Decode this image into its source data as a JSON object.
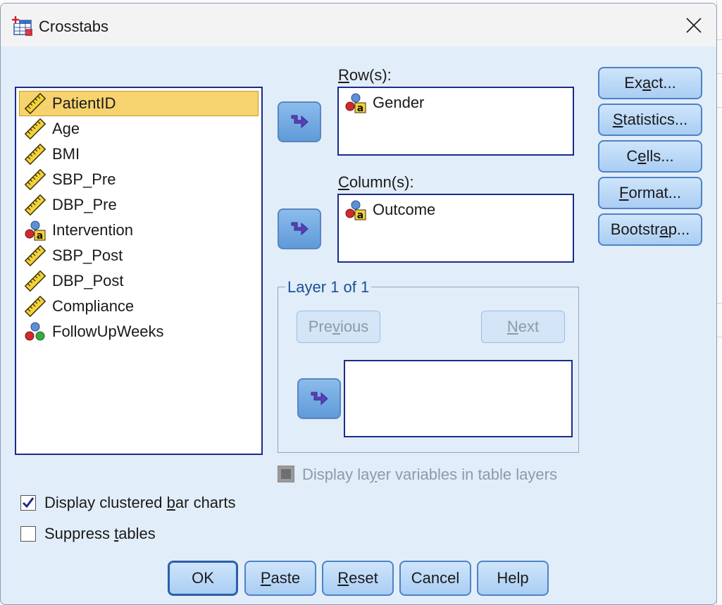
{
  "window": {
    "title": "Crosstabs"
  },
  "variables": [
    {
      "label": "PatientID",
      "icon": "scale-ruler-icon",
      "selected": true
    },
    {
      "label": "Age",
      "icon": "scale-ruler-icon"
    },
    {
      "label": "BMI",
      "icon": "scale-ruler-icon"
    },
    {
      "label": "SBP_Pre",
      "icon": "scale-ruler-icon"
    },
    {
      "label": "DBP_Pre",
      "icon": "scale-ruler-icon"
    },
    {
      "label": "Intervention",
      "icon": "nominal-string-icon"
    },
    {
      "label": "SBP_Post",
      "icon": "scale-ruler-icon"
    },
    {
      "label": "DBP_Post",
      "icon": "scale-ruler-icon"
    },
    {
      "label": "Compliance",
      "icon": "scale-ruler-icon"
    },
    {
      "label": "FollowUpWeeks",
      "icon": "nominal-icon"
    }
  ],
  "rows": {
    "label": "Row(s):",
    "items": [
      {
        "label": "Gender",
        "icon": "nominal-string-icon"
      }
    ]
  },
  "columns": {
    "label": "Column(s):",
    "items": [
      {
        "label": "Outcome",
        "icon": "nominal-string-icon"
      }
    ]
  },
  "layer": {
    "title": "Layer 1 of 1",
    "previous": "Previous",
    "next": "Next"
  },
  "side_buttons": {
    "exact": "Exact...",
    "statistics": "Statistics...",
    "cells": "Cells...",
    "format": "Format...",
    "bootstrap": "Bootstrap..."
  },
  "options": {
    "display_layer_vars": {
      "label": "Display layer variables in table layers",
      "checked": true,
      "enabled": false
    },
    "clustered_bar": {
      "label": "Display clustered bar charts",
      "checked": true
    },
    "suppress_tables": {
      "label": "Suppress tables",
      "checked": false
    }
  },
  "footer": {
    "ok": "OK",
    "paste": "Paste",
    "reset": "Reset",
    "cancel": "Cancel",
    "help": "Help"
  },
  "colors": {
    "dialog_bg": "#e1edf8",
    "selection": "#f7d36f",
    "list_border": "#1c2b8a",
    "button": "#a9cdf3"
  }
}
